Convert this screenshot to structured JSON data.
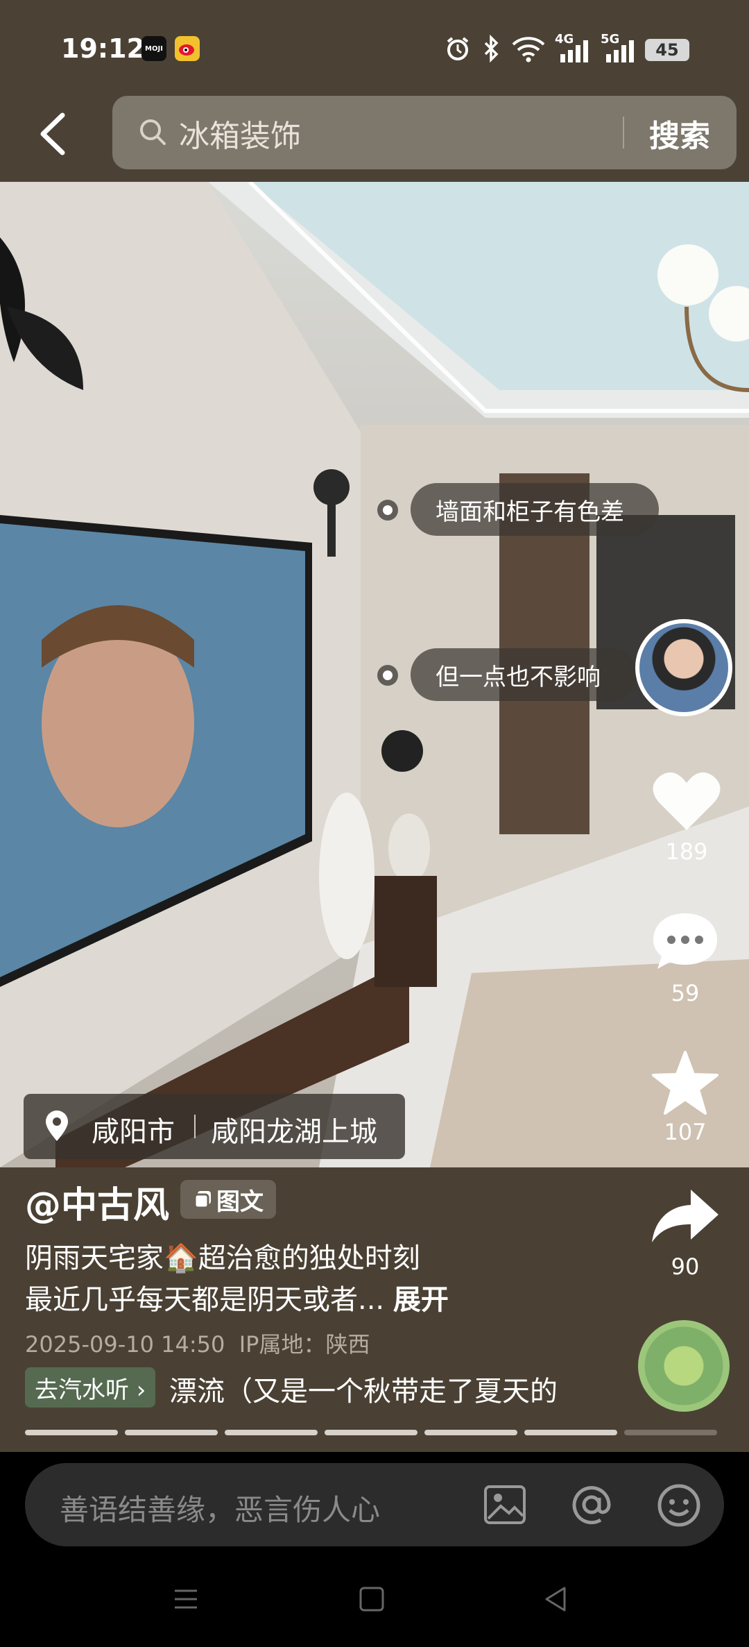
{
  "status_bar": {
    "time": "19:12",
    "apps": [
      "moji-weather",
      "weibo"
    ],
    "network_4g": "4G",
    "network_5g": "5G",
    "battery": "45",
    "icons": [
      "alarm-icon",
      "bluetooth-icon",
      "wifi-icon",
      "signal-icon",
      "battery-icon"
    ]
  },
  "search": {
    "query": "冰箱装饰",
    "button_label": "搜索"
  },
  "photo": {
    "tags": [
      "墙面和柜子有色差",
      "但一点也不影响"
    ]
  },
  "actions": {
    "likes": "189",
    "comments": "59",
    "favorites": "107",
    "shares": "90"
  },
  "location": {
    "city": "咸阳市",
    "place": "咸阳龙湖上城"
  },
  "post": {
    "author": "@中古风",
    "type": "图文",
    "desc_line1": "阴雨天宅家🏠超治愈的独处时刻",
    "desc_line2": "最近几乎每天都是阴天或者... ",
    "expand": "展开",
    "datetime": "2025-09-10 14:50",
    "ip_location": "IP属地：陕西"
  },
  "music": {
    "chip": "去汽水听 ›",
    "title": "漂流（又是一个秋带走了夏天的"
  },
  "progress": {
    "total_pages": 7,
    "current_page": 6
  },
  "comment": {
    "placeholder": "善语结善缘，恶言伤人心"
  },
  "colors": {
    "header_bg": "#4b4235",
    "info_bg": "#4a4134",
    "chip_green": "#556a50"
  }
}
